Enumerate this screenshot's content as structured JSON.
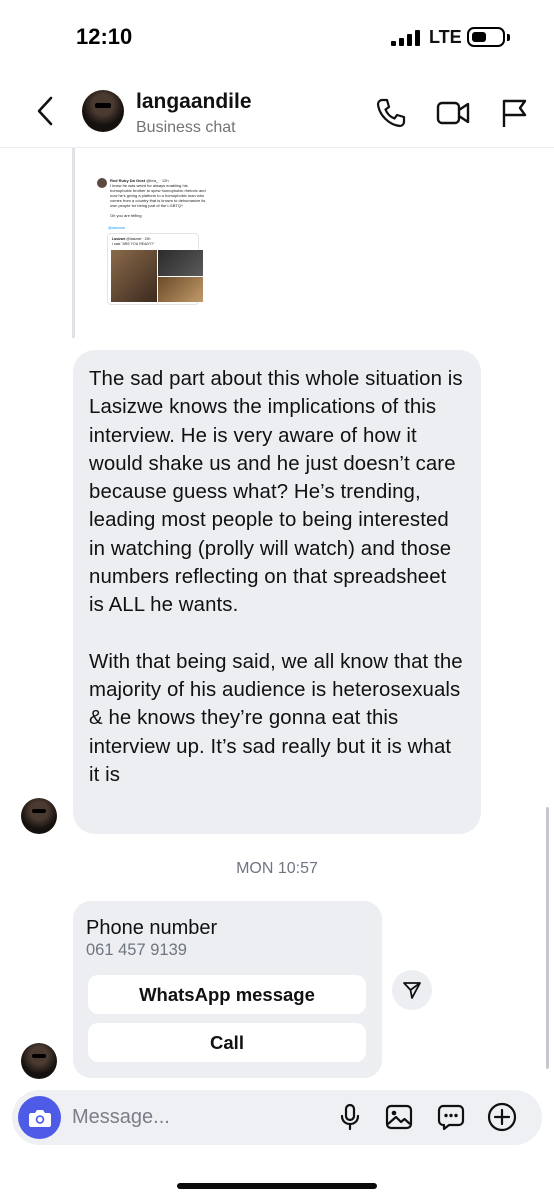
{
  "status_bar": {
    "time": "12:10",
    "network": "LTE",
    "icons": [
      "signal-icon",
      "battery-icon"
    ]
  },
  "header": {
    "name": "langaandile",
    "subtitle": "Business chat",
    "icons": [
      "back-chevron-icon",
      "phone-icon",
      "video-camera-icon",
      "flag-icon"
    ]
  },
  "shared_post": {
    "author": "Red Ruby Da Gost",
    "author_meta": "@bra_ · 12h",
    "text": "I knew he was weird for always enabling his homophobic brother to spew homophobic rhetoric and now he's giving a platform to a homophobic man who comes from a country that is known to dehumanize its own people for being part of the LGBTQ+",
    "subtext": "Oh you are trifling",
    "link": "@lasizwe",
    "quoted_author": "Lasizwe",
    "quoted_meta": "@lasizwe · 15h",
    "quoted_text": "I said \"ARE YOU READY?\""
  },
  "messages": [
    {
      "sender": "langaandile",
      "paragraphs": [
        "The sad part about this whole situation is Lasizwe knows the implications of this interview. He is very aware of how it would shake us and he just doesn’t care because guess what? He’s trending, leading most people to being interested in watching (prolly will watch) and those numbers reflecting on that spreadsheet is ALL he wants.",
        "With that being said, we all know that the majority of his audience is heterosexuals & he knows they’re gonna eat this interview up. It’s sad really but it is what it is"
      ]
    }
  ],
  "timestamp": "MON 10:57",
  "contact_card": {
    "title": "Phone number",
    "number": "061 457 9139",
    "buttons": [
      "WhatsApp message",
      "Call"
    ]
  },
  "composer": {
    "placeholder": "Message...",
    "icons": [
      "camera-icon",
      "microphone-icon",
      "image-icon",
      "sticker-chat-icon",
      "plus-circle-icon"
    ]
  },
  "colors": {
    "bubble_bg": "#eceef1",
    "camera_button": "#4e5be6",
    "muted_text": "#737373"
  }
}
